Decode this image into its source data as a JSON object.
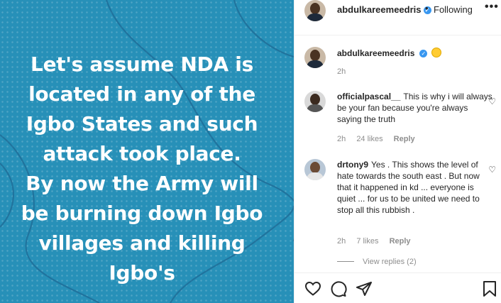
{
  "post": {
    "lines": [
      "Let's assume NDA is",
      "located in any of the",
      "Igbo States and such",
      "attack took place.",
      "By now the Army will",
      "be burning down Igbo",
      "villages and killing",
      "Igbo's"
    ],
    "background_color": "#2790b8"
  },
  "header": {
    "username": "abdulkareemeedris",
    "verified_icon": "verified-badge-icon",
    "separator": "•",
    "follow_label": "Following",
    "more_label": "•••"
  },
  "caption": {
    "username": "abdulkareemeedris",
    "emoji": "thinking-face",
    "time": "2h"
  },
  "comments": [
    {
      "username": "officialpascal__",
      "text": "This is why i will always be your fan because you're always saying the truth",
      "time": "2h",
      "likes": "24 likes",
      "reply": "Reply"
    },
    {
      "username": "drtony9",
      "text": "Yes . This shows the level of hate towards the south east . But now that it happened in kd ... everyone is quiet ... for us to be united we need to stop all this rubbish .",
      "time": "2h",
      "likes": "7 likes",
      "reply": "Reply",
      "view_replies": "View replies (2)"
    }
  ],
  "actions": {
    "icons": [
      "heart-icon",
      "comment-icon",
      "share-icon",
      "bookmark-icon"
    ]
  }
}
